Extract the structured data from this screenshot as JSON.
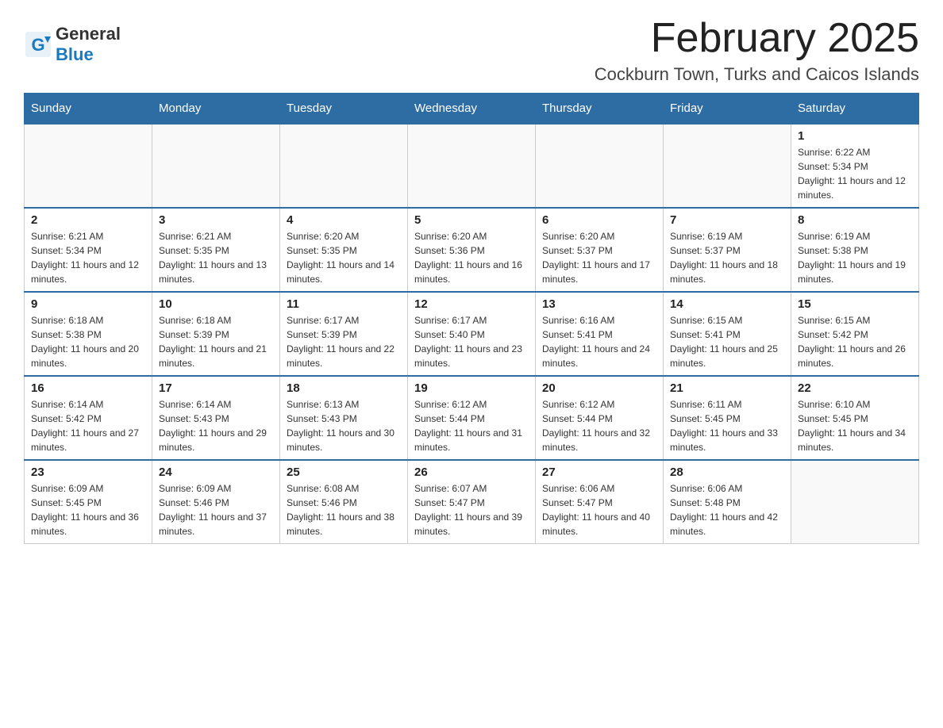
{
  "header": {
    "logo_general": "General",
    "logo_blue": "Blue",
    "month_title": "February 2025",
    "location": "Cockburn Town, Turks and Caicos Islands"
  },
  "days_of_week": [
    "Sunday",
    "Monday",
    "Tuesday",
    "Wednesday",
    "Thursday",
    "Friday",
    "Saturday"
  ],
  "weeks": [
    {
      "days": [
        {
          "number": "",
          "info": ""
        },
        {
          "number": "",
          "info": ""
        },
        {
          "number": "",
          "info": ""
        },
        {
          "number": "",
          "info": ""
        },
        {
          "number": "",
          "info": ""
        },
        {
          "number": "",
          "info": ""
        },
        {
          "number": "1",
          "info": "Sunrise: 6:22 AM\nSunset: 5:34 PM\nDaylight: 11 hours and 12 minutes."
        }
      ]
    },
    {
      "days": [
        {
          "number": "2",
          "info": "Sunrise: 6:21 AM\nSunset: 5:34 PM\nDaylight: 11 hours and 12 minutes."
        },
        {
          "number": "3",
          "info": "Sunrise: 6:21 AM\nSunset: 5:35 PM\nDaylight: 11 hours and 13 minutes."
        },
        {
          "number": "4",
          "info": "Sunrise: 6:20 AM\nSunset: 5:35 PM\nDaylight: 11 hours and 14 minutes."
        },
        {
          "number": "5",
          "info": "Sunrise: 6:20 AM\nSunset: 5:36 PM\nDaylight: 11 hours and 16 minutes."
        },
        {
          "number": "6",
          "info": "Sunrise: 6:20 AM\nSunset: 5:37 PM\nDaylight: 11 hours and 17 minutes."
        },
        {
          "number": "7",
          "info": "Sunrise: 6:19 AM\nSunset: 5:37 PM\nDaylight: 11 hours and 18 minutes."
        },
        {
          "number": "8",
          "info": "Sunrise: 6:19 AM\nSunset: 5:38 PM\nDaylight: 11 hours and 19 minutes."
        }
      ]
    },
    {
      "days": [
        {
          "number": "9",
          "info": "Sunrise: 6:18 AM\nSunset: 5:38 PM\nDaylight: 11 hours and 20 minutes."
        },
        {
          "number": "10",
          "info": "Sunrise: 6:18 AM\nSunset: 5:39 PM\nDaylight: 11 hours and 21 minutes."
        },
        {
          "number": "11",
          "info": "Sunrise: 6:17 AM\nSunset: 5:39 PM\nDaylight: 11 hours and 22 minutes."
        },
        {
          "number": "12",
          "info": "Sunrise: 6:17 AM\nSunset: 5:40 PM\nDaylight: 11 hours and 23 minutes."
        },
        {
          "number": "13",
          "info": "Sunrise: 6:16 AM\nSunset: 5:41 PM\nDaylight: 11 hours and 24 minutes."
        },
        {
          "number": "14",
          "info": "Sunrise: 6:15 AM\nSunset: 5:41 PM\nDaylight: 11 hours and 25 minutes."
        },
        {
          "number": "15",
          "info": "Sunrise: 6:15 AM\nSunset: 5:42 PM\nDaylight: 11 hours and 26 minutes."
        }
      ]
    },
    {
      "days": [
        {
          "number": "16",
          "info": "Sunrise: 6:14 AM\nSunset: 5:42 PM\nDaylight: 11 hours and 27 minutes."
        },
        {
          "number": "17",
          "info": "Sunrise: 6:14 AM\nSunset: 5:43 PM\nDaylight: 11 hours and 29 minutes."
        },
        {
          "number": "18",
          "info": "Sunrise: 6:13 AM\nSunset: 5:43 PM\nDaylight: 11 hours and 30 minutes."
        },
        {
          "number": "19",
          "info": "Sunrise: 6:12 AM\nSunset: 5:44 PM\nDaylight: 11 hours and 31 minutes."
        },
        {
          "number": "20",
          "info": "Sunrise: 6:12 AM\nSunset: 5:44 PM\nDaylight: 11 hours and 32 minutes."
        },
        {
          "number": "21",
          "info": "Sunrise: 6:11 AM\nSunset: 5:45 PM\nDaylight: 11 hours and 33 minutes."
        },
        {
          "number": "22",
          "info": "Sunrise: 6:10 AM\nSunset: 5:45 PM\nDaylight: 11 hours and 34 minutes."
        }
      ]
    },
    {
      "days": [
        {
          "number": "23",
          "info": "Sunrise: 6:09 AM\nSunset: 5:45 PM\nDaylight: 11 hours and 36 minutes."
        },
        {
          "number": "24",
          "info": "Sunrise: 6:09 AM\nSunset: 5:46 PM\nDaylight: 11 hours and 37 minutes."
        },
        {
          "number": "25",
          "info": "Sunrise: 6:08 AM\nSunset: 5:46 PM\nDaylight: 11 hours and 38 minutes."
        },
        {
          "number": "26",
          "info": "Sunrise: 6:07 AM\nSunset: 5:47 PM\nDaylight: 11 hours and 39 minutes."
        },
        {
          "number": "27",
          "info": "Sunrise: 6:06 AM\nSunset: 5:47 PM\nDaylight: 11 hours and 40 minutes."
        },
        {
          "number": "28",
          "info": "Sunrise: 6:06 AM\nSunset: 5:48 PM\nDaylight: 11 hours and 42 minutes."
        },
        {
          "number": "",
          "info": ""
        }
      ]
    }
  ]
}
